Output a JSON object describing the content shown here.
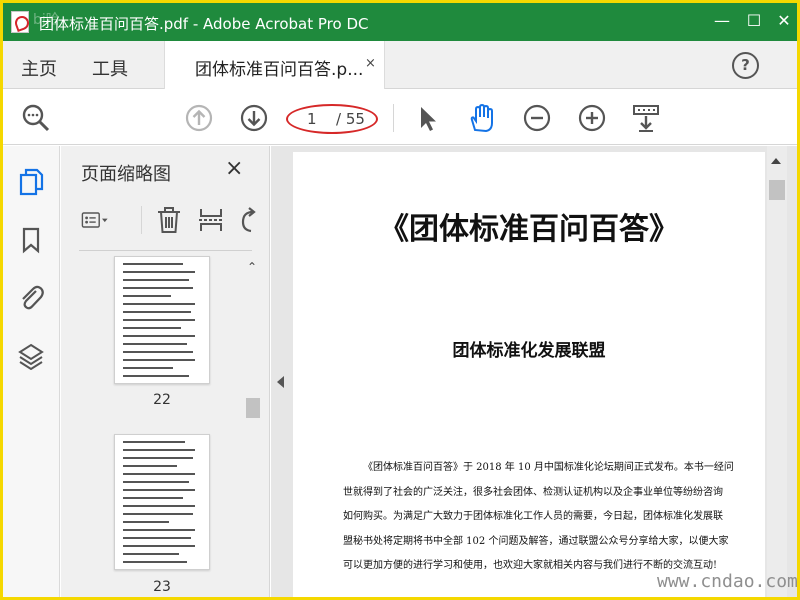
{
  "window": {
    "title": "团体标准百问百答.pdf - Adobe Acrobat Pro DC",
    "minimize": "—",
    "maximize": "☐",
    "close": "✕",
    "watermark_top": "bj哈"
  },
  "tabs": {
    "home": "主页",
    "tools": "工具",
    "document": "团体标准百问百答.p...",
    "document_close": "×",
    "help": "?"
  },
  "toolbar": {
    "current_page": "1",
    "total_pages": "/ 55"
  },
  "panel": {
    "title": "页面缩略图",
    "close": "×",
    "thumbnails": [
      {
        "page_label": "22"
      },
      {
        "page_label": "23"
      }
    ]
  },
  "document": {
    "title": "《团体标准百问百答》",
    "subtitle": "团体标准化发展联盟",
    "paragraph_lines": [
      "《团体标准百问百答》于 2018 年 10 月中国标准化论坛期间正式发布。本书一经问",
      "世就得到了社会的广泛关注，很多社会团体、检测认证机构以及企事业单位等纷纷咨询",
      "如何购买。为满足广大致力于团体标准化工作人员的需要，今日起，团体标准化发展联",
      "盟秘书处将定期将书中全部 102 个问题及解答，通过联盟公众号分享给大家，以便大家",
      "可以更加方便的进行学习和使用，也欢迎大家就相关内容与我们进行不断的交流互动!"
    ]
  },
  "watermark": "www.cndao.com",
  "colors": {
    "title_bar": "#1f8a3d",
    "annotation_circle": "#d62828",
    "accent_blue": "#1473e6",
    "outer_border": "#f5d800"
  },
  "icons": {
    "search": "magnifier-icon",
    "prev_page": "arrow-up-circle-icon",
    "next_page": "arrow-down-circle-icon",
    "select": "arrow-pointer-icon",
    "hand": "hand-icon",
    "zoom_out": "minus-circle-icon",
    "zoom_in": "plus-circle-icon",
    "read_mode": "keyboard-down-icon"
  }
}
